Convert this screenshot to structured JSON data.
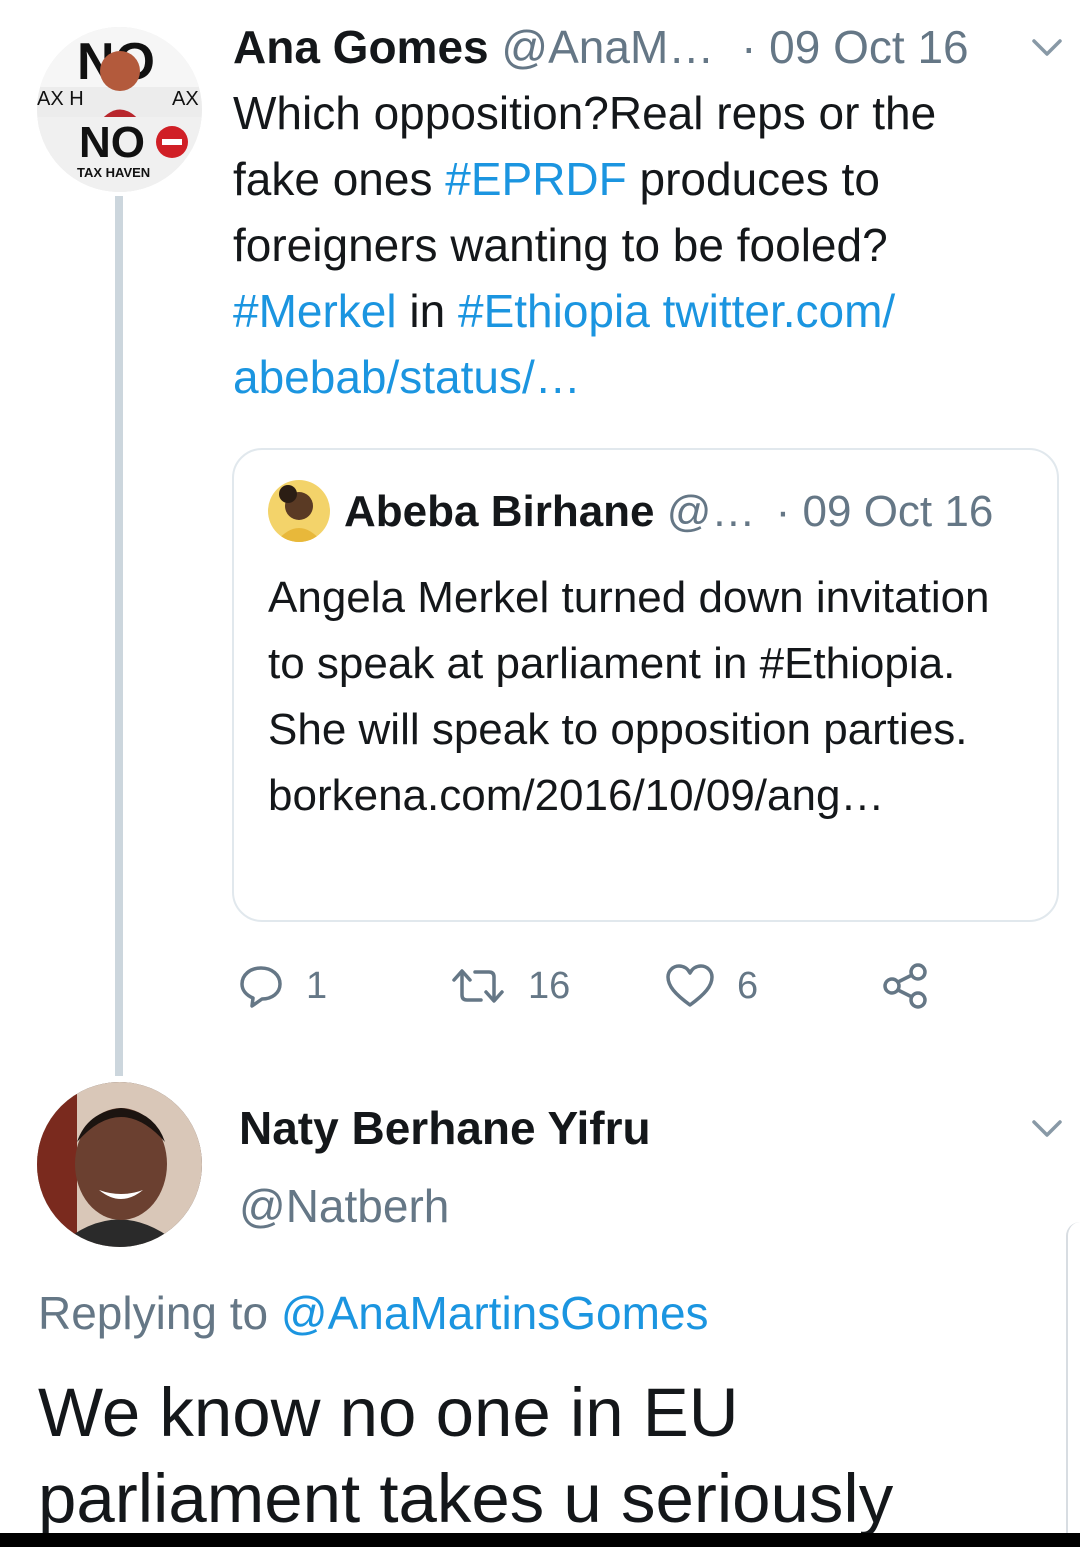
{
  "tweet1": {
    "name": "Ana Gomes",
    "handle": "@AnaM…",
    "date": "· 09 Oct 16",
    "avatar_text": {
      "top": "NO",
      "side_left": "AX H",
      "side_right": "AX",
      "middle": "NO",
      "bottom": "TAX HAVEN"
    },
    "body_parts": [
      {
        "text": "Which opposition?Real reps or the fake ones ",
        "type": "text"
      },
      {
        "text": "#EPRDF",
        "type": "link"
      },
      {
        "text": " produces to foreigners wanting to be fooled? ",
        "type": "text"
      },
      {
        "text": "#Merkel",
        "type": "link"
      },
      {
        "text": " in ",
        "type": "text"
      },
      {
        "text": "#Ethiopia",
        "type": "link"
      },
      {
        "text": " twitter.com/ abebab/status/…",
        "type": "link"
      }
    ],
    "quote": {
      "name": "Abeba Birhane",
      "handle": "@…",
      "date": "· 09 Oct 16",
      "body": "Angela Merkel turned down invitation to speak at parliament in #Ethiopia. She will speak to opposition parties. borkena.com/2016/10/09/ang…"
    },
    "actions": {
      "reply_count": "1",
      "retweet_count": "16",
      "like_count": "6"
    }
  },
  "tweet2": {
    "name": "Naty Berhane Yifru",
    "handle": "@Natberh",
    "replying_prefix": "Replying to ",
    "replying_handle": "@AnaMartinsGomes",
    "body": "We know no one in EU parliament takes u seriously"
  },
  "colors": {
    "link": "#1b95e0",
    "secondary": "#657786",
    "thread_line": "#ccd6dd",
    "border": "#e1e8ed"
  },
  "icons": [
    "chevron-down-icon",
    "reply-icon",
    "retweet-icon",
    "like-icon",
    "share-icon"
  ]
}
